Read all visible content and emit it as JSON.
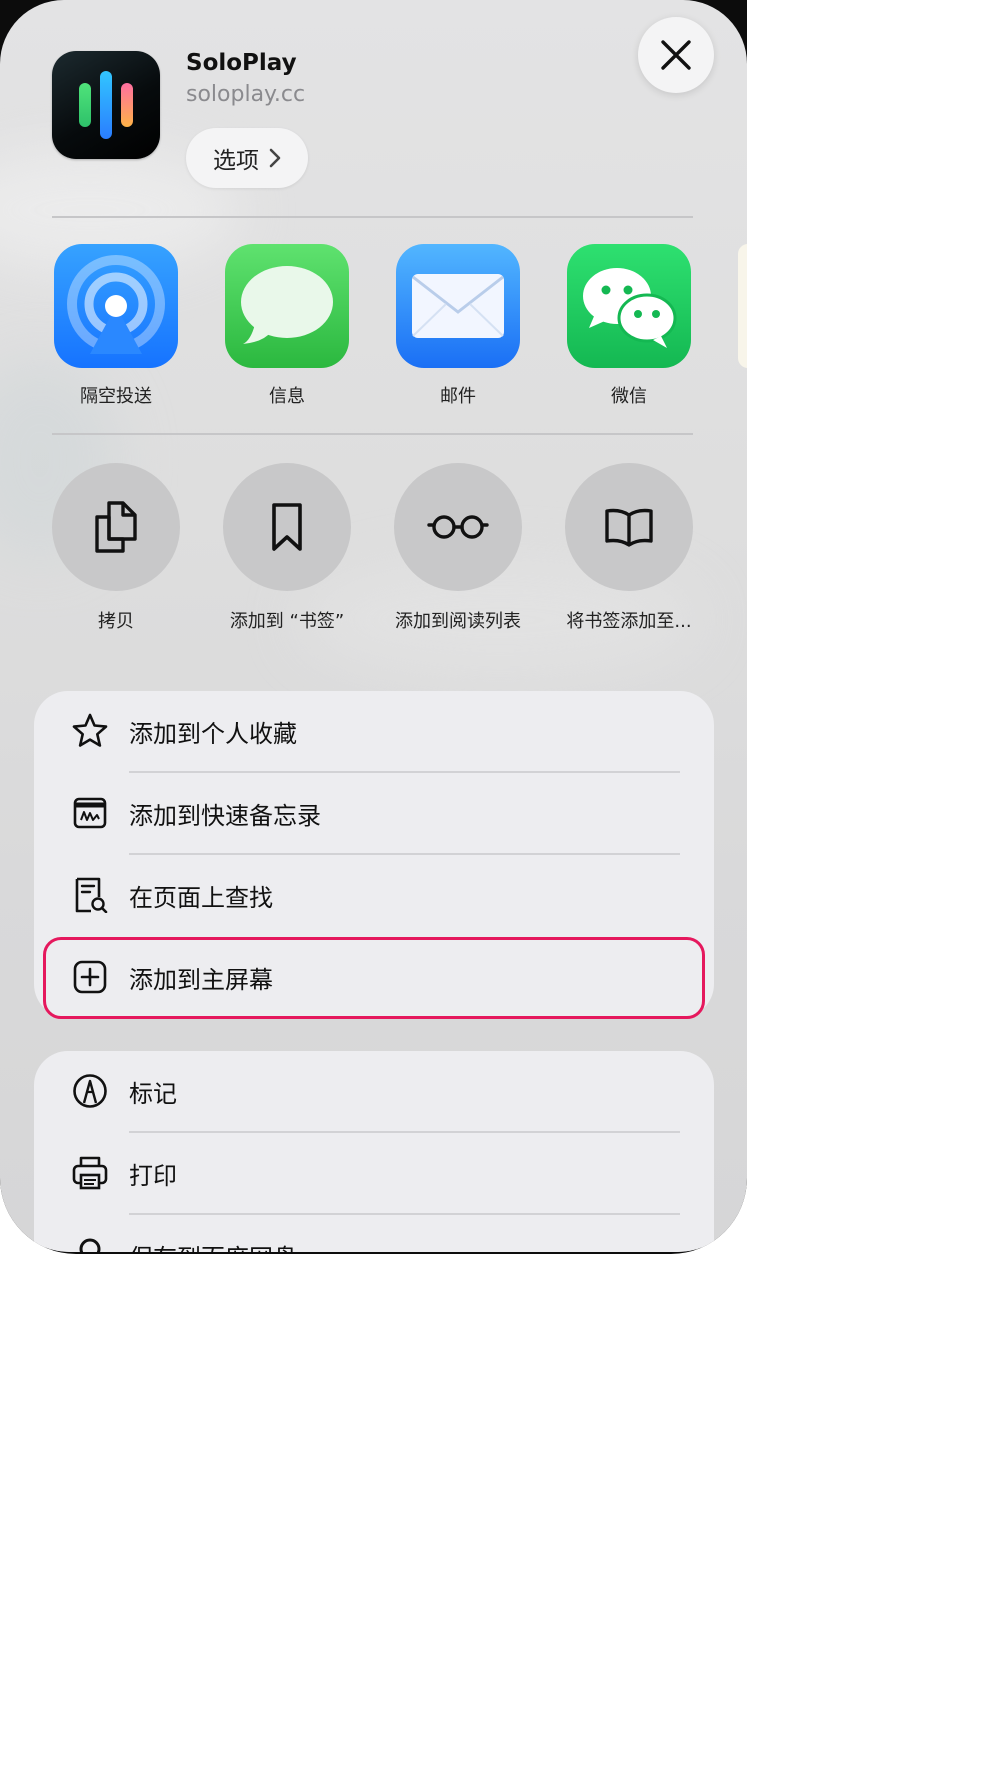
{
  "header": {
    "app_name": "SoloPlay",
    "app_url": "soloplay.cc",
    "options_label": "选项"
  },
  "share_apps": [
    {
      "label": "隔空投送",
      "icon": "airdrop-icon"
    },
    {
      "label": "信息",
      "icon": "messages-icon"
    },
    {
      "label": "邮件",
      "icon": "mail-icon"
    },
    {
      "label": "微信",
      "icon": "wechat-icon"
    }
  ],
  "actions": [
    {
      "label": "拷贝",
      "icon": "copy-icon"
    },
    {
      "label": "添加到 “书签”",
      "icon": "bookmark-icon"
    },
    {
      "label": "添加到阅读列表",
      "icon": "glasses-icon"
    },
    {
      "label": "将书签添加至...",
      "icon": "book-icon"
    }
  ],
  "menu_group_1": [
    {
      "label": "添加到个人收藏",
      "icon": "star-icon"
    },
    {
      "label": "添加到快速备忘录",
      "icon": "quick-note-icon"
    },
    {
      "label": "在页面上查找",
      "icon": "find-on-page-icon"
    },
    {
      "label": "添加到主屏幕",
      "icon": "add-square-icon",
      "highlighted": true
    }
  ],
  "menu_group_2": [
    {
      "label": "标记",
      "icon": "markup-icon"
    },
    {
      "label": "打印",
      "icon": "printer-icon"
    },
    {
      "label": "保存到百度网盘",
      "icon": "baidu-pan-icon"
    }
  ],
  "colors": {
    "highlight": "#e5185d",
    "airdrop": "#1f8bff",
    "messages": "#34c759",
    "mail": "#1f7bff",
    "wechat": "#1ec45c"
  }
}
